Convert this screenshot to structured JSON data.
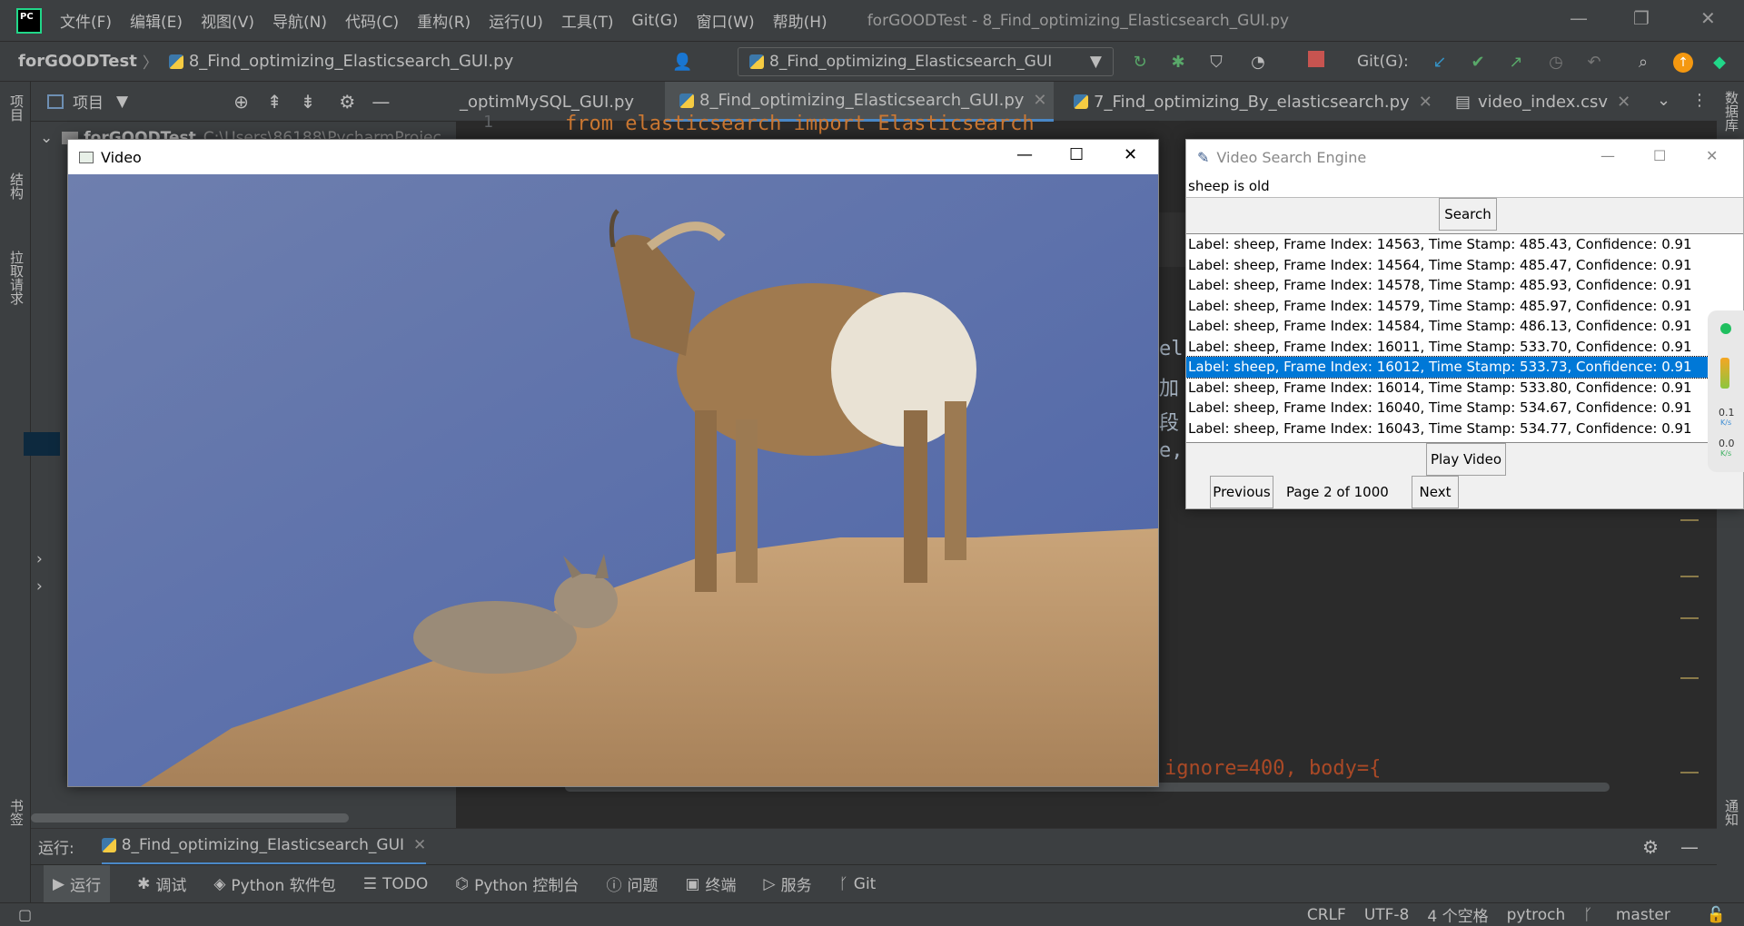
{
  "app": {
    "window_title": "forGOODTest - 8_Find_optimizing_Elasticsearch_GUI.py",
    "logo_text": "PC",
    "menu": [
      "文件(F)",
      "编辑(E)",
      "视图(V)",
      "导航(N)",
      "代码(C)",
      "重构(R)",
      "运行(U)",
      "工具(T)",
      "Git(G)",
      "窗口(W)",
      "帮助(H)"
    ]
  },
  "navbar": {
    "project": "forGOODTest",
    "file": "8_Find_optimizing_Elasticsearch_GUI.py",
    "run_config": "8_Find_optimizing_Elasticsearch_GUI",
    "git_label": "Git(G):"
  },
  "left_strip": {
    "items": [
      "项目",
      "结构",
      "拉取请求",
      "书签"
    ]
  },
  "project_panel": {
    "header": "项目",
    "root": "forGOODTest",
    "root_path": "C:\\Users\\86188\\PycharmProjec"
  },
  "editor": {
    "tabs": [
      {
        "label": "_optimMySQL_GUI.py"
      },
      {
        "label": "8_Find_optimizing_Elasticsearch_GUI.py"
      },
      {
        "label": "7_Find_optimizing_By_elasticsearch.py"
      },
      {
        "label": "video_index.csv"
      }
    ],
    "line_number": "1",
    "code_line1": "from elasticsearch import Elasticsearch",
    "fragments": [
      "el",
      "加",
      "段",
      "e,"
    ],
    "code_bottom": "ignore=400, body={"
  },
  "right_strip": {
    "items": [
      "数据库",
      "通知"
    ]
  },
  "video_window": {
    "title": "Video"
  },
  "search_window": {
    "title": "Video Search Engine",
    "query": "sheep is old",
    "search_button": "Search",
    "results": [
      "Label: sheep, Frame Index: 14563, Time Stamp: 485.43, Confidence: 0.91",
      "Label: sheep, Frame Index: 14564, Time Stamp: 485.47, Confidence: 0.91",
      "Label: sheep, Frame Index: 14578, Time Stamp: 485.93, Confidence: 0.91",
      "Label: sheep, Frame Index: 14579, Time Stamp: 485.97, Confidence: 0.91",
      "Label: sheep, Frame Index: 14584, Time Stamp: 486.13, Confidence: 0.91",
      "Label: sheep, Frame Index: 16011, Time Stamp: 533.70, Confidence: 0.91",
      "Label: sheep, Frame Index: 16012, Time Stamp: 533.73, Confidence: 0.91",
      "Label: sheep, Frame Index: 16014, Time Stamp: 533.80, Confidence: 0.91",
      "Label: sheep, Frame Index: 16040, Time Stamp: 534.67, Confidence: 0.91",
      "Label: sheep, Frame Index: 16043, Time Stamp: 534.77, Confidence: 0.91"
    ],
    "selected_index": 6,
    "play_button": "Play Video",
    "previous_button": "Previous",
    "page_info": "Page 2 of 1000",
    "next_button": "Next"
  },
  "net_widget": {
    "up": "0.1",
    "up_unit": "K/s",
    "down": "0.0",
    "down_unit": "K/s"
  },
  "run_panel": {
    "label": "运行:",
    "tab": "8_Find_optimizing_Elasticsearch_GUI"
  },
  "bottom_tools": [
    "运行",
    "调试",
    "Python 软件包",
    "TODO",
    "Python 控制台",
    "问题",
    "终端",
    "服务",
    "Git"
  ],
  "status_bar": {
    "line_sep": "CRLF",
    "encoding": "UTF-8",
    "indent": "4 个空格",
    "interpreter": "pytroch",
    "branch": "master"
  },
  "colors": {
    "ide_bg": "#2b2b2b",
    "panel_bg": "#3c3f41",
    "selection": "#0078d7",
    "keyword": "#cc7832",
    "number": "#6897bb",
    "param": "#aa4926"
  }
}
